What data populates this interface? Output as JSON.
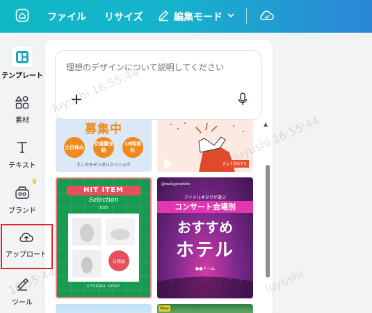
{
  "topbar": {
    "home_icon": "home-icon",
    "file_label": "ファイル",
    "resize_label": "リサイズ",
    "edit_mode_label": "編集モード",
    "edit_icon": "pencil-icon",
    "chevron_icon": "chevron-down-icon",
    "cloud_icon": "cloud-check-icon"
  },
  "sidebar": {
    "items": [
      {
        "label": "テンプレート",
        "icon": "template-icon",
        "active": true
      },
      {
        "label": "素材",
        "icon": "shapes-icon"
      },
      {
        "label": "テキスト",
        "icon": "text-icon"
      },
      {
        "label": "ブランド",
        "icon": "brand-icon",
        "badge": "crown-icon"
      },
      {
        "label": "アップロード",
        "icon": "cloud-upload-icon",
        "highlighted": true
      },
      {
        "label": "ツール",
        "icon": "tools-icon"
      }
    ]
  },
  "panel": {
    "prompt_placeholder": "理想のデザインについて説明してください",
    "add_icon": "plus-icon",
    "mic_icon": "microphone-icon"
  },
  "templates": {
    "recruit": {
      "title": "募集中",
      "c1": "土日休み",
      "c2": "交通費支給",
      "c3": "18時退社",
      "footer": "すこやかデンタルクリニック"
    },
    "hand": {
      "tag": "きょう見逃すな"
    },
    "hit": {
      "top": "HIT ITEM",
      "sub": "Selection",
      "year": "2025",
      "badge": "日用品",
      "footer": "UTSUWA SHOP"
    },
    "concert": {
      "small": "@reallygreatsite",
      "kicker": "アイドルオタクが選ぶ",
      "band": "コンサート会場別",
      "big1": "おすすめ",
      "big2": "ホテル",
      "dome": "●●ドーム"
    },
    "next_tag": "New"
  },
  "watermark": {
    "user": "luyushi",
    "time": "16:55:44"
  },
  "colors": {
    "topbar_start": "#10b8c6",
    "topbar_end": "#2b86d8",
    "highlight": "#e8242b"
  }
}
